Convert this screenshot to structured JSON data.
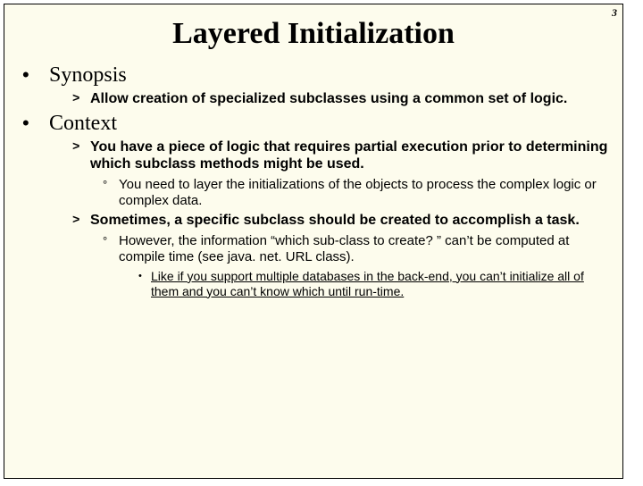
{
  "page_number": "3",
  "title": "Layered Initialization",
  "sections": [
    {
      "heading": "Synopsis",
      "items": [
        {
          "text": "Allow creation of specialized subclasses using a common set of logic."
        }
      ]
    },
    {
      "heading": "Context",
      "items": [
        {
          "text": "You have a piece of logic that requires partial execution prior to determining which subclass methods might be used.",
          "sub": [
            {
              "text": "You need to layer the initializations of the objects to process the complex logic or complex data."
            }
          ]
        },
        {
          "text": "Sometimes, a specific subclass should be created to accomplish a task.",
          "sub": [
            {
              "text": "However, the information “which sub-class to create? ” can’t be computed at compile time (see java. net. URL class).",
              "sub": [
                {
                  "text": "Like if you support multiple databases in the back-end, you can’t initialize all of them and you can’t know which until run-time."
                }
              ]
            }
          ]
        }
      ]
    }
  ]
}
